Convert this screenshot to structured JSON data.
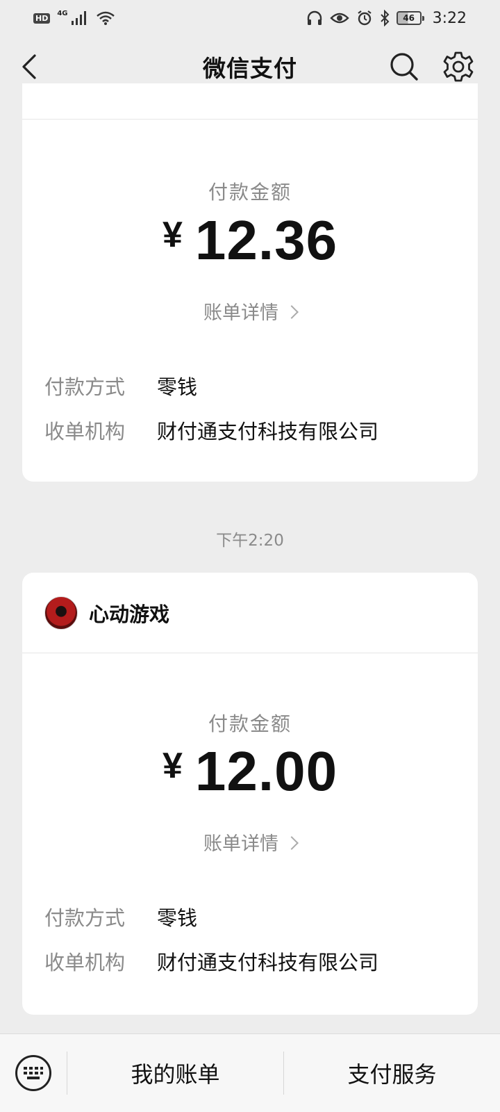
{
  "status_bar": {
    "hd": "HD",
    "network": "4G",
    "battery": "46",
    "time": "3:22"
  },
  "nav": {
    "title": "微信支付"
  },
  "cards": [
    {
      "amount_label": "付款金额",
      "currency": "¥",
      "amount": "12.36",
      "detail_link": "账单详情",
      "payment_method_label": "付款方式",
      "payment_method": "零钱",
      "acquirer_label": "收单机构",
      "acquirer": "财付通支付科技有限公司"
    },
    {
      "merchant": "心动游戏",
      "amount_label": "付款金额",
      "currency": "¥",
      "amount": "12.00",
      "detail_link": "账单详情",
      "payment_method_label": "付款方式",
      "payment_method": "零钱",
      "acquirer_label": "收单机构",
      "acquirer": "财付通支付科技有限公司"
    }
  ],
  "timestamp": "下午2:20",
  "bottom_bar": {
    "my_bills": "我的账单",
    "pay_services": "支付服务"
  },
  "icons": [
    "back-icon",
    "search-icon",
    "gear-icon",
    "keyboard-icon"
  ]
}
